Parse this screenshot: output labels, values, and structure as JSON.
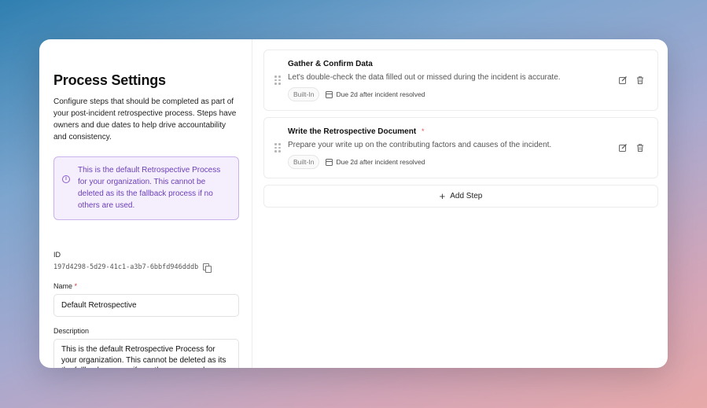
{
  "settings": {
    "title": "Process Settings",
    "subtitle": "Configure steps that should be completed as part of your post-incident retrospective process. Steps have owners and due dates to help drive accountability and consistency.",
    "info": "This is the default Retrospective Process for your organization. This cannot be deleted as its the fallback process if no others are used.",
    "id_label": "ID",
    "id_value": "197d4298-5d29-41c1-a3b7-6bbfd946dddb",
    "name_label": "Name",
    "required_marker": "*",
    "name_value": "Default Retrospective",
    "description_label": "Description",
    "description_value": "This is the default Retrospective Process for your organization. This cannot be deleted as its the fallback process if no others are used."
  },
  "steps": [
    {
      "title": "Gather & Confirm Data",
      "required_marker": "",
      "description": "Let's double-check the data filled out or missed during the incident is accurate.",
      "badge": "Built-In",
      "due": "Due 2d after incident resolved"
    },
    {
      "title": "Write the Retrospective Document",
      "required_marker": "*",
      "description": "Prepare your write up on the contributing factors and causes of the incident.",
      "badge": "Built-In",
      "due": "Due 2d after incident resolved"
    }
  ],
  "add_step": {
    "icon": "+",
    "label": "Add Step"
  },
  "colors": {
    "accent_purple": "#6b3fb8",
    "info_bg": "#f5effd",
    "required_red": "#d43b3b"
  },
  "icons": {
    "info": "info-icon",
    "copy": "copy-icon",
    "drag": "drag-handle-icon",
    "calendar": "calendar-icon",
    "edit": "edit-icon",
    "trash": "trash-icon",
    "plus": "plus-icon"
  }
}
